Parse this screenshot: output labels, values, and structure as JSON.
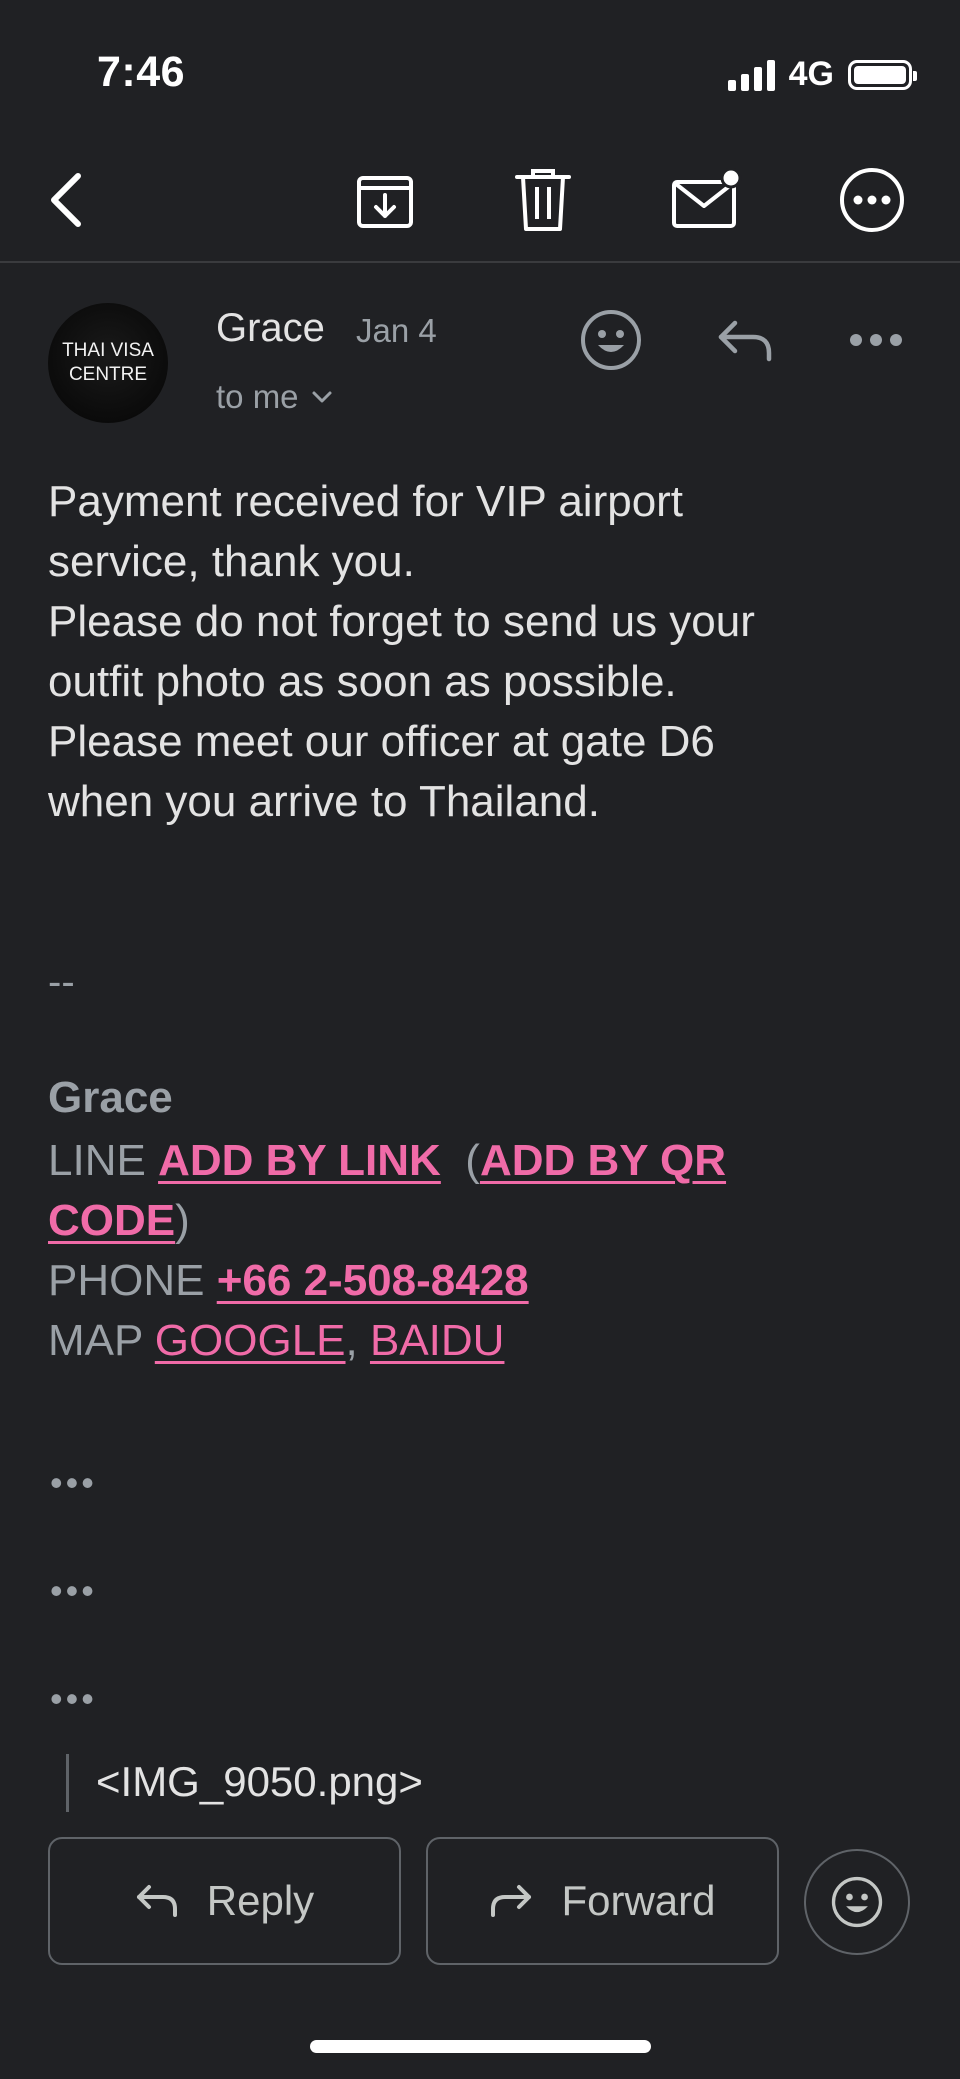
{
  "status": {
    "time": "7:46",
    "network": "4G"
  },
  "email": {
    "avatar_text_1": "THAI VISA",
    "avatar_text_2": "CENTRE",
    "sender": "Grace",
    "date": "Jan 4",
    "recipient": "to me",
    "body_lines": [
      "Payment received for VIP airport",
      "service, thank you.",
      "Please do not forget to send us your",
      "outfit photo as soon as possible.",
      "Please meet our officer at gate D6",
      "when you arrive to Thailand."
    ],
    "signature": {
      "dash": "--",
      "name": "Grace",
      "line_label": "LINE",
      "add_by_link": "ADD BY LINK",
      "add_by_qr_1": "ADD BY QR",
      "add_by_qr_2": "CODE",
      "phone_label": "PHONE",
      "phone": "+66 2-508-8428",
      "map_label": "MAP",
      "map_google": "GOOGLE",
      "map_baidu": "BAIDU"
    },
    "collapsed_marker": "•••",
    "attachment": "<IMG_9050.png>"
  },
  "actions": {
    "reply": "Reply",
    "forward": "Forward"
  },
  "colors": {
    "background": "#202124",
    "link": "#f06ba8",
    "muted": "#9aa0a6"
  }
}
